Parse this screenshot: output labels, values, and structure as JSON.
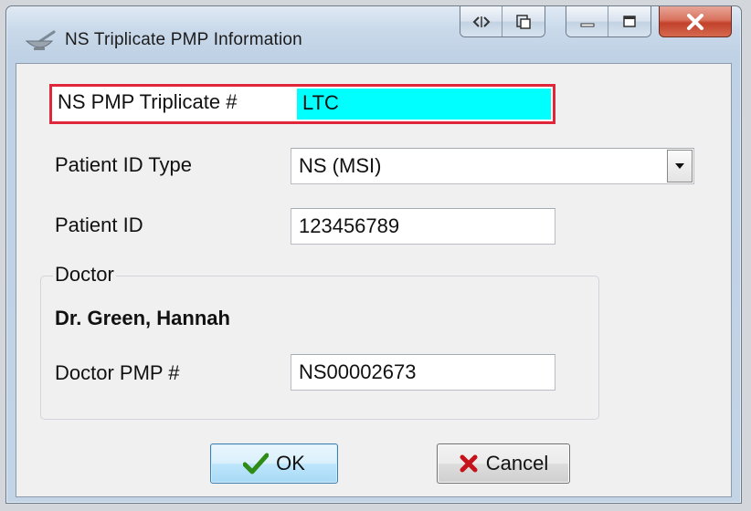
{
  "window": {
    "title": "NS Triplicate PMP Information"
  },
  "titlebar_buttons": {
    "extra": [
      "code-icon",
      "restore-icon"
    ],
    "controls": [
      "minimize-icon",
      "maximize-icon"
    ],
    "close": "close-icon"
  },
  "form": {
    "triplicate_label": "NS PMP Triplicate #",
    "triplicate_value": "LTC",
    "patient_id_type_label": "Patient ID Type",
    "patient_id_type_value": "NS (MSI)",
    "patient_id_label": "Patient ID",
    "patient_id_value": "123456789"
  },
  "doctor": {
    "group_title": "Doctor",
    "name": "Dr. Green, Hannah",
    "pmp_label": "Doctor PMP #",
    "pmp_value": "NS00002673"
  },
  "buttons": {
    "ok_label": "OK",
    "cancel_label": "Cancel"
  },
  "colors": {
    "highlight_border": "#e0263a",
    "triplicate_fill": "#00ffff",
    "close_button": "#c2412b",
    "ok_check": "#2e8b16",
    "cancel_x": "#c4131b"
  }
}
